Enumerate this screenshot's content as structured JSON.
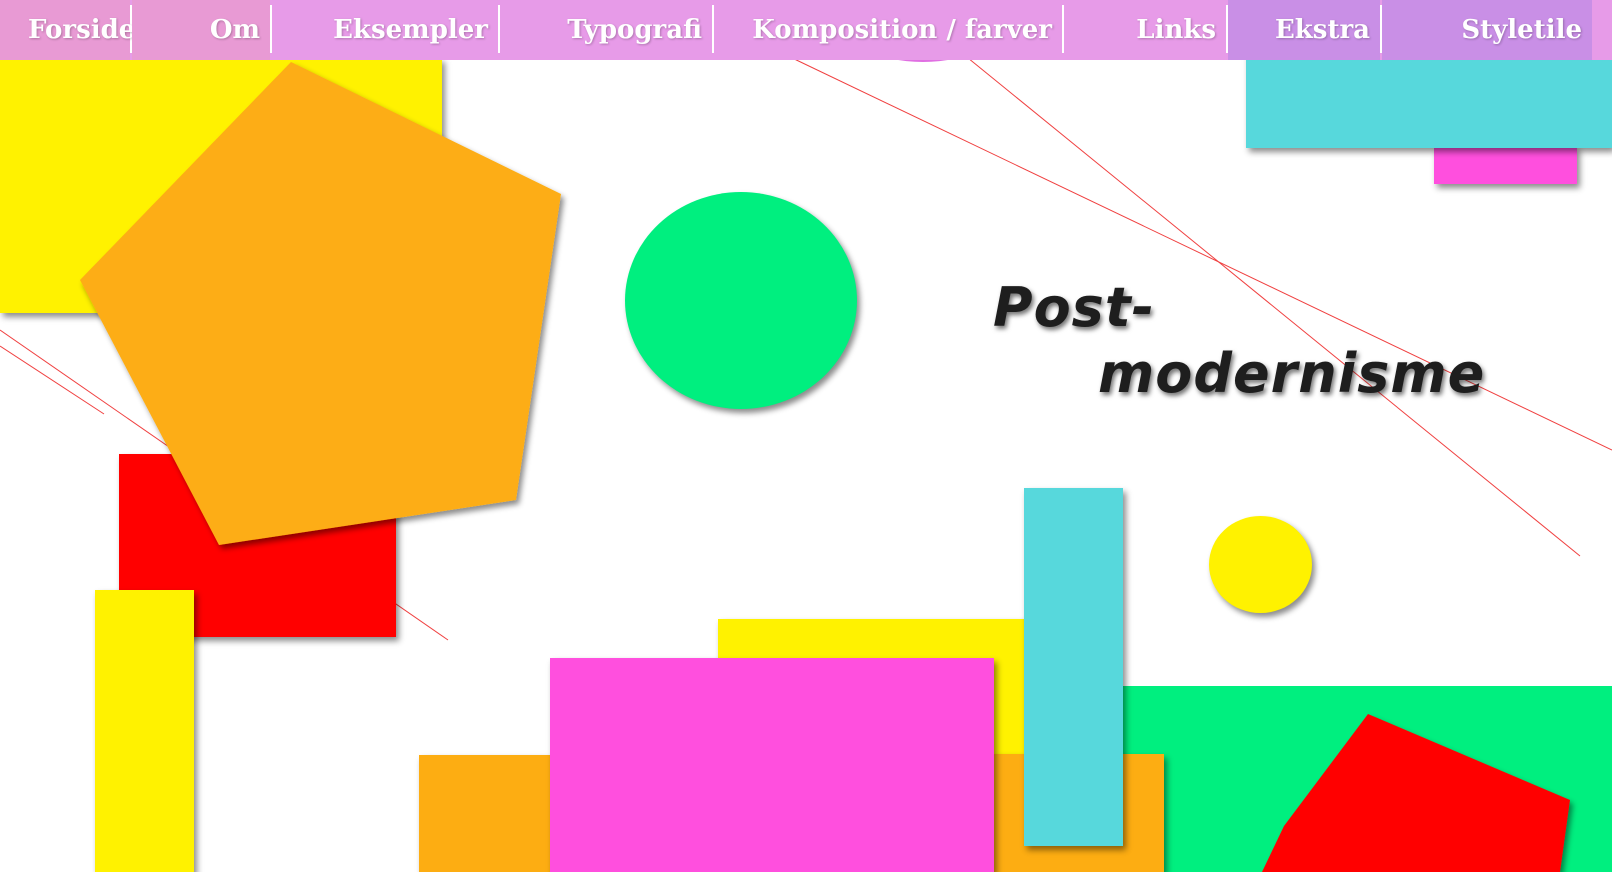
{
  "nav": {
    "items": [
      {
        "label": "Forside"
      },
      {
        "label": "Om"
      },
      {
        "label": "Eksempler"
      },
      {
        "label": "Typografi"
      },
      {
        "label": "Komposition / farver"
      },
      {
        "label": "Links"
      },
      {
        "label": "Ekstra"
      },
      {
        "label": "Styletile"
      }
    ]
  },
  "hero": {
    "title_line1": "Post-",
    "title_line2": "modernisme"
  },
  "colors": {
    "nav_bg": "#e79be8",
    "yellow": "#fff200",
    "orange": "#fdad12",
    "red": "#ff0000",
    "green": "#00ef7f",
    "cyan": "#57d8dc",
    "magenta": "#ff4fde"
  }
}
